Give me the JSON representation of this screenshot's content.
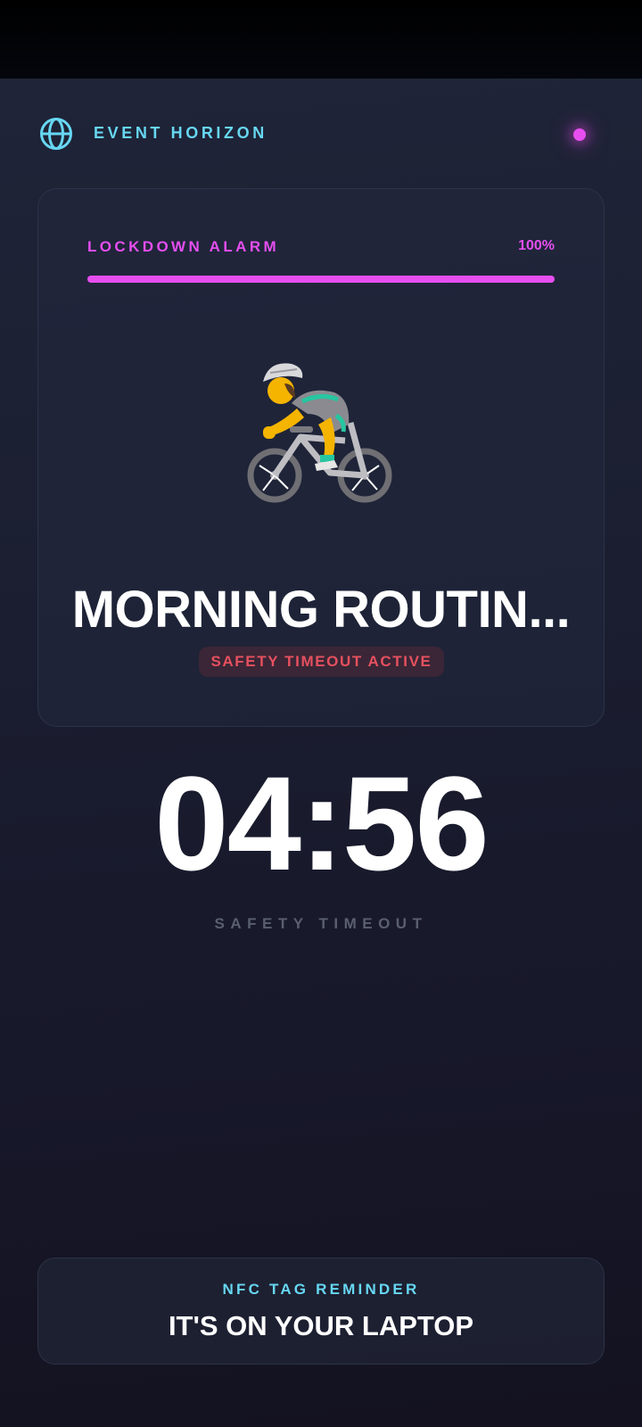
{
  "header": {
    "app_title": "EVENT HORIZON",
    "globe_icon": "globe-icon",
    "status_dot_color": "#e64ef0"
  },
  "alarm_card": {
    "label": "LOCKDOWN ALARM",
    "percent_text": "100%",
    "progress": 1.0,
    "activity_icon": "person-biking-emoji",
    "title": "MORNING ROUTIN...",
    "badge": "SAFETY TIMEOUT ACTIVE"
  },
  "timer": {
    "value": "04:56",
    "label": "SAFETY TIMEOUT"
  },
  "nfc_card": {
    "label": "NFC TAG REMINDER",
    "value": "IT'S ON YOUR LAPTOP"
  },
  "colors": {
    "accent_magenta": "#e64ef0",
    "accent_cyan": "#67d7f2",
    "badge_red": "#e6505f",
    "background": "#1b1f31"
  }
}
